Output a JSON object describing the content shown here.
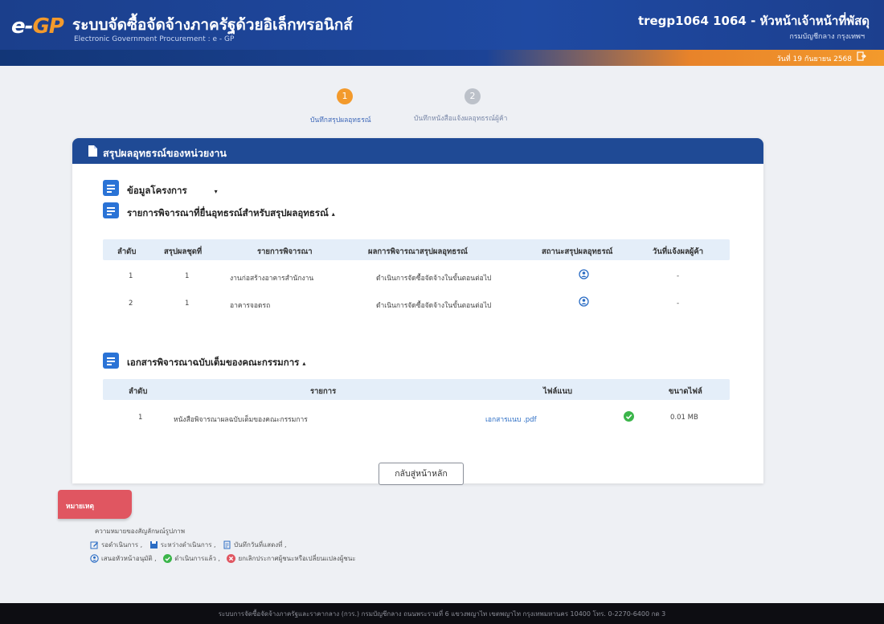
{
  "header": {
    "logo_e": "e-",
    "logo_gp": "GP",
    "title": "ระบบจัดซื้อจัดจ้างภาครัฐด้วยอิเล็กทรอนิกส์",
    "subtitle": "Electronic Government Procurement : e - GP",
    "user_name": "tregp1064 1064 - หัวหน้าเจ้าหน้าที่พัสดุ",
    "user_org": "กรมบัญชีกลาง กรุงเทพฯ",
    "date": "วันที่ 19 กันยายน 2568"
  },
  "stepper": {
    "steps": [
      {
        "number": "1",
        "label": "บันทึกสรุปผลอุทธรณ์"
      },
      {
        "number": "2",
        "label": "บันทึกหนังสือแจ้งผลอุทธรณ์ผู้ค้า"
      }
    ]
  },
  "panel": {
    "title": "สรุปผลอุทธรณ์ของหน่วยงาน",
    "project_section": "ข้อมูลโครงการ",
    "items_section": "รายการพิจารณาที่ยื่นอุทธรณ์สำหรับสรุปผลอุทธรณ์",
    "items_table": {
      "headers": [
        "ลำดับ",
        "สรุปผลชุดที่",
        "รายการพิจารณา",
        "ผลการพิจารณาสรุปผลอุทธรณ์",
        "สถานะสรุปผลอุทธรณ์",
        "วันที่แจ้งผลผู้ค้า"
      ],
      "rows": [
        [
          "1",
          "1",
          "งานก่อสร้างอาคารสำนักงาน",
          "ดำเนินการจัดซื้อจัดจ้างในขั้นตอนต่อไป",
          "-"
        ],
        [
          "2",
          "1",
          "อาคารจอดรถ",
          "ดำเนินการจัดซื้อจัดจ้างในขั้นตอนต่อไป",
          "-"
        ]
      ]
    },
    "docs_section": "เอกสารพิจารณาฉบับเต็มของคณะกรรมการ",
    "docs_table": {
      "headers": [
        "ลำดับ",
        "รายการ",
        "ไฟล์แนบ",
        "ขนาดไฟล์"
      ],
      "rows": [
        [
          "1",
          "หนังสือพิจารณาผลฉบับเต็มของคณะกรรมการ",
          "เอกสารแนบ .pdf",
          "0.01 MB"
        ]
      ]
    },
    "back_button": "กลับสู่หน้าหลัก"
  },
  "legend": {
    "tab_label": "หมายเหตุ",
    "heading": "ความหมายของสัญลักษณ์รูปภาพ",
    "row1": [
      "รอดำเนินการ ,",
      "ระหว่างดำเนินการ ,",
      "บันทึกวันที่แสดงที่ ,"
    ],
    "row2": [
      "เสนอหัวหน้าอนุมัติ ,",
      "ดำเนินการแล้ว ,",
      "ยกเลิกประกาศผู้ชนะหรือเปลี่ยนแปลงผู้ชนะ"
    ]
  },
  "footer": {
    "text": "ระบบการจัดซื้อจัดจ้างภาครัฐและราคากลาง (กวร.) กรมบัญชีกลาง ถนนพระรามที่ 6 แขวงพญาไท เขตพญาไท กรุงเทพมหานคร 10400 โทร. 0-2270-6400 กด 3"
  },
  "colors": {
    "header_blue": "#1f4aa3",
    "accent_orange": "#f39a2c",
    "panel_header": "#1f4a95",
    "badge_blue": "#2a73d6",
    "success_green": "#3bb54a",
    "legend_red": "#e05661"
  }
}
